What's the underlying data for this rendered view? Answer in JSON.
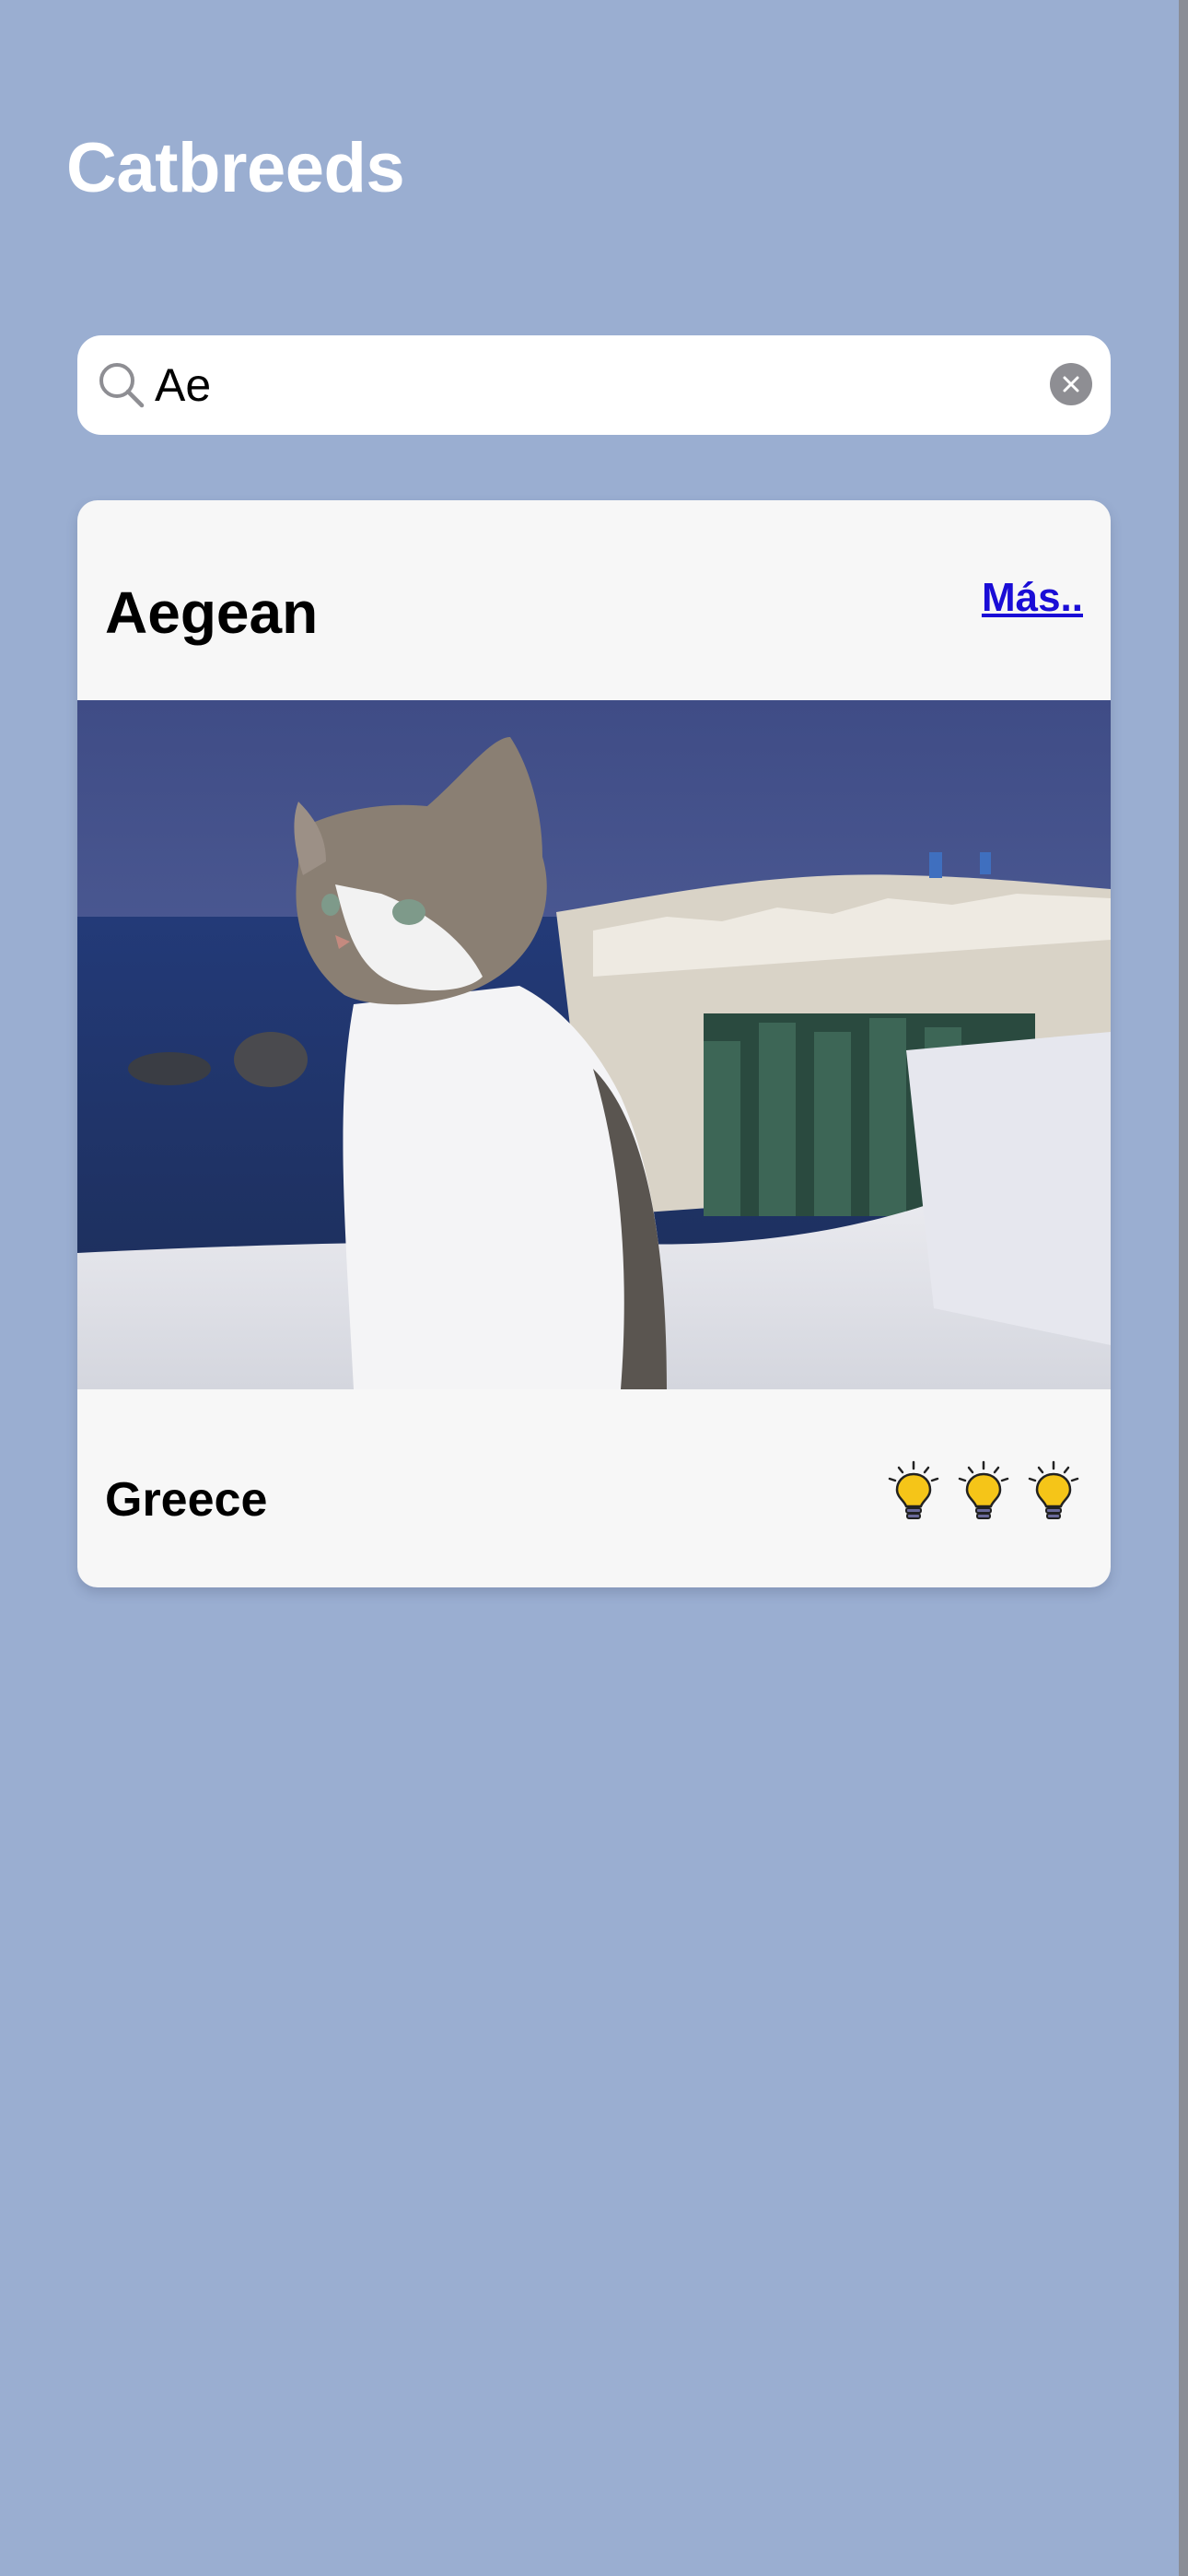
{
  "app": {
    "title": "Catbreeds"
  },
  "search": {
    "value": "Ae",
    "placeholder": ""
  },
  "results": [
    {
      "name": "Aegean",
      "more_label": "Más..",
      "origin": "Greece",
      "photo_icon": "cat-photo",
      "rating": 3,
      "rating_icon": "lightbulb-icon"
    }
  ],
  "colors": {
    "background": "#9aaed1",
    "card": "#f7f7f7",
    "link": "#1a0dd6",
    "bulb": "#f5c518"
  }
}
